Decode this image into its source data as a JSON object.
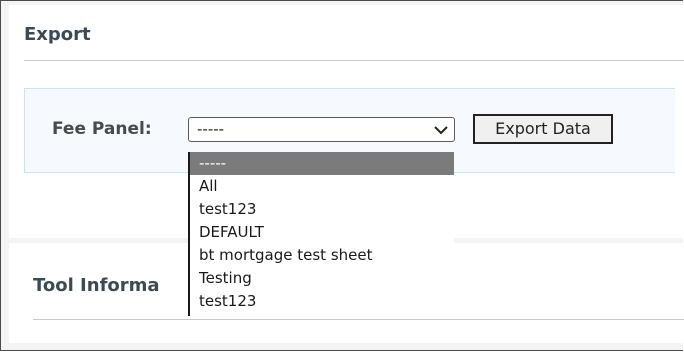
{
  "export": {
    "heading": "Export",
    "fee_panel_label": "Fee Panel:",
    "selected_value": "-----",
    "export_button_label": "Export Data"
  },
  "dropdown": {
    "options": [
      "-----",
      "All",
      "test123",
      "DEFAULT",
      "bt mortgage test sheet",
      "Testing",
      "test123"
    ],
    "highlighted_index": 0
  },
  "tool_info": {
    "heading": "Tool Informa"
  },
  "icons": {
    "select_arrow": "chevron-down-icon"
  }
}
